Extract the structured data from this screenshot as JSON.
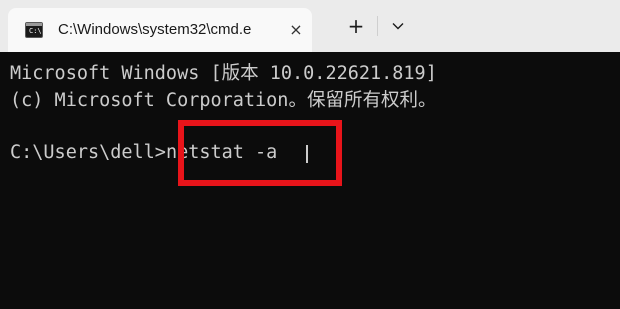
{
  "window": {
    "tab_title": "C:\\Windows\\system32\\cmd.e",
    "tab_icon": "cmd-icon",
    "tab_icon_glyph": "C:\\",
    "close_glyph": "×",
    "new_tab_glyph": "+",
    "dropdown_icon": "chevron-down-icon"
  },
  "terminal": {
    "lines": [
      "Microsoft Windows [版本 10.0.22621.819]",
      "(c) Microsoft Corporation。保留所有权利。"
    ],
    "prompt": "C:\\Users\\dell>",
    "command": "netstat -a"
  },
  "annotation": {
    "highlight_color": "#e8141a"
  }
}
